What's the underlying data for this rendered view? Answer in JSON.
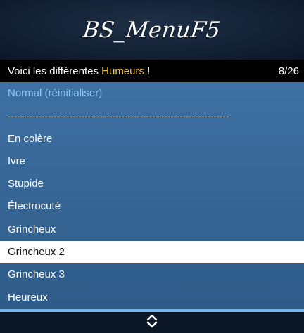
{
  "banner": {
    "title": "BS_MenuF5"
  },
  "subtitle": {
    "prefix": "Voici les différentes ",
    "highlight": "Humeurs",
    "suffix": " !",
    "counter": "8/26"
  },
  "items": [
    {
      "label": "Normal (réinitialiser)"
    },
    {
      "label": "------------------------------------------------------------------------"
    },
    {
      "label": "En colère"
    },
    {
      "label": "Ivre"
    },
    {
      "label": "Stupide"
    },
    {
      "label": "Électrocuté"
    },
    {
      "label": "Grincheux"
    },
    {
      "label": "Grincheux 2"
    },
    {
      "label": "Grincheux 3"
    },
    {
      "label": "Heureux"
    }
  ],
  "selected_index": 7,
  "colors": {
    "highlight": "#f4c44a",
    "reset_item": "#8ec6f2",
    "accent": "#6fb3ea",
    "list_background": "#3a6b9c"
  },
  "footer": {
    "icon": "up-down-arrows-icon"
  }
}
